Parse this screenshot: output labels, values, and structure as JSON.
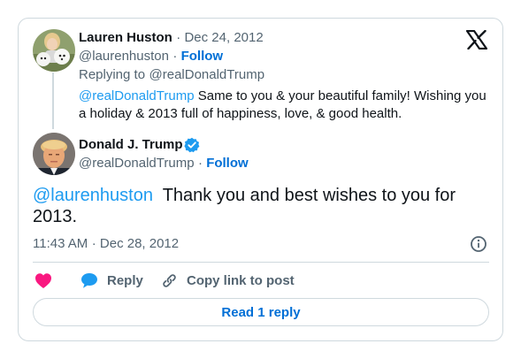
{
  "reply_tweet": {
    "author_name": "Lauren Huston",
    "date": "Dec 24, 2012",
    "handle": "@laurenhuston",
    "follow_label": "Follow",
    "replying_to_label": "Replying to",
    "replying_to_handle": "@realDonaldTrump",
    "mention": "@realDonaldTrump",
    "body_line1_rest": "Same to you & your beautiful family! Wishing you",
    "body_line2": "a holiday & 2013 full of happiness, love, & good health."
  },
  "main_tweet": {
    "author_name": "Donald J. Trump",
    "verified": true,
    "handle": "@realDonaldTrump",
    "follow_label": "Follow",
    "mention": "@laurenhuston",
    "text_line1_rest": "Thank you and best wishes to you for",
    "text_line2": "2013.",
    "time": "11:43 AM",
    "date": "Dec 28, 2012"
  },
  "actions": {
    "like_icon": "heart-icon",
    "reply_label": "Reply",
    "copy_link_label": "Copy link to post",
    "read_replies_label": "Read 1 reply"
  },
  "colors": {
    "link_blue": "#1d9bf0",
    "follow_blue": "#006fd6",
    "heart_pink": "#f91880",
    "secondary_text": "#536471",
    "border": "#cfd9de"
  }
}
